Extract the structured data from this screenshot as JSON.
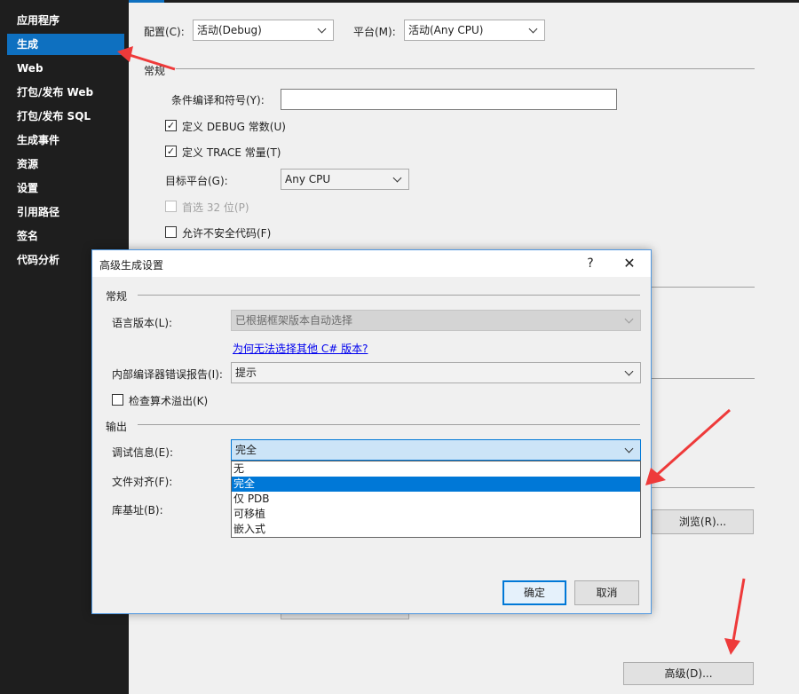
{
  "sidebar": {
    "items": [
      {
        "label": "应用程序"
      },
      {
        "label": "生成"
      },
      {
        "label": "Web"
      },
      {
        "label": "打包/发布 Web"
      },
      {
        "label": "打包/发布 SQL"
      },
      {
        "label": "生成事件"
      },
      {
        "label": "资源"
      },
      {
        "label": "设置"
      },
      {
        "label": "引用路径"
      },
      {
        "label": "签名"
      },
      {
        "label": "代码分析"
      }
    ],
    "active_index": 1
  },
  "build_page": {
    "config_label": "配置(C):",
    "config_value": "活动(Debug)",
    "platform_label": "平台(M):",
    "platform_value": "活动(Any CPU)",
    "general_heading": "常规",
    "conditional_symbols_label": "条件编译和符号(Y):",
    "conditional_symbols_value": "",
    "define_debug_label": "定义 DEBUG 常数(U)",
    "define_debug_checked": true,
    "define_trace_label": "定义 TRACE 常量(T)",
    "define_trace_checked": true,
    "target_platform_label": "目标平台(G):",
    "target_platform_value": "Any CPU",
    "prefer32_label": "首选 32 位(P)",
    "prefer32_checked": false,
    "allow_unsafe_label": "允许不安全代码(F)",
    "allow_unsafe_checked": false,
    "browse_button": "浏览(R)...",
    "advanced_button": "高级(D)..."
  },
  "dialog": {
    "title": "高级生成设置",
    "help_icon": "?",
    "close_icon": "✕",
    "general_heading": "常规",
    "language_version_label": "语言版本(L):",
    "language_version_value": "已根据框架版本自动选择",
    "why_link": "为何无法选择其他 C# 版本?",
    "internal_error_label": "内部编译器错误报告(I):",
    "internal_error_value": "提示",
    "check_overflow_label": "检查算术溢出(K)",
    "check_overflow_checked": false,
    "output_heading": "输出",
    "debug_info_label": "调试信息(E):",
    "debug_info_value": "完全",
    "debug_info_options": [
      "无",
      "完全",
      "仅 PDB",
      "可移植",
      "嵌入式"
    ],
    "debug_info_selected_index": 1,
    "file_alignment_label": "文件对齐(F):",
    "base_address_label": "库基址(B):",
    "ok_button": "确定",
    "cancel_button": "取消"
  },
  "colors": {
    "sidebar_bg": "#1e1e1e",
    "accent": "#0e70c0",
    "selection": "#0078d7",
    "annotation_arrow": "#ee3a3a"
  }
}
